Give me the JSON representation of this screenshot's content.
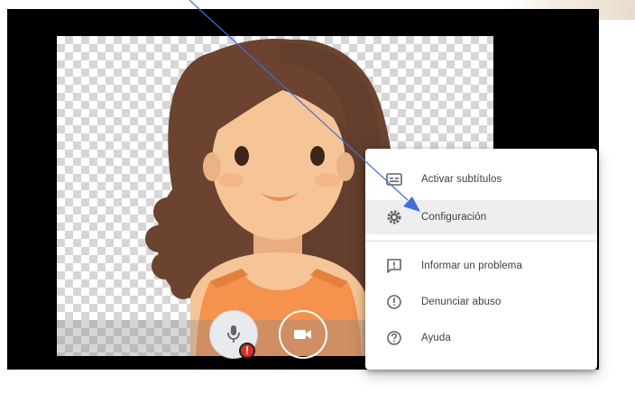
{
  "menu": {
    "items": [
      {
        "label": "Activar subtítulos",
        "icon": "closed-captions-icon"
      },
      {
        "label": "Configuración",
        "icon": "settings-gear-icon"
      },
      {
        "label": "Informar un problema",
        "icon": "feedback-icon"
      },
      {
        "label": "Denunciar abuso",
        "icon": "report-abuse-icon"
      },
      {
        "label": "Ayuda",
        "icon": "help-icon"
      }
    ],
    "highlighted_item": "Configuración"
  },
  "controls": {
    "microphone": {
      "icon": "microphone-icon",
      "alert_badge": "!"
    },
    "camera": {
      "icon": "camera-icon"
    }
  },
  "preview": {
    "avatar": "avatar-illustration"
  },
  "colors": {
    "frame_bg": "#000000",
    "menu_bg": "#ffffff",
    "menu_highlight": "#eeeeef",
    "badge_red": "#d93025",
    "arrow_blue": "#3f6fd8",
    "hair": "#6b4330",
    "skin": "#f6c597",
    "dress": "#f4924e"
  }
}
